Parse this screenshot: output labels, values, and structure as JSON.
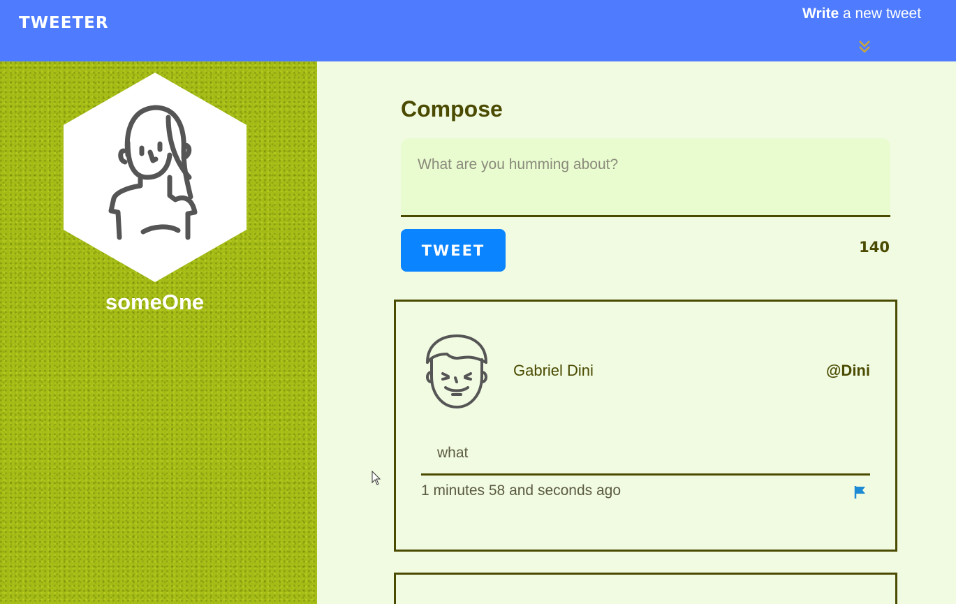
{
  "nav": {
    "brand": "TWEETER",
    "write_bold": "Write",
    "write_rest": " a new tweet",
    "chevron_icon": "double-chevron-down-icon",
    "bg_color": "#4f7cff",
    "chevron_color": "#c9a63a"
  },
  "profile": {
    "avatar_icon": "woman-avatar-icon",
    "username": "someOne",
    "sidebar_color": "#a4bb16"
  },
  "compose": {
    "title": "Compose",
    "placeholder": "What are you humming about?",
    "value": "",
    "button_label": "TWEET",
    "counter": "140",
    "button_color": "#0a84ff"
  },
  "tweets": [
    {
      "avatar_icon": "man-avatar-icon",
      "author": "Gabriel Dini",
      "handle": "@Dini",
      "body": "what",
      "time": "1 minutes 58 and seconds ago",
      "flag_icon": "flag-icon",
      "flag_color": "#1c8ad4"
    }
  ],
  "colors": {
    "main_bg": "#f1fbe2",
    "text_dark": "#4a4a00"
  }
}
